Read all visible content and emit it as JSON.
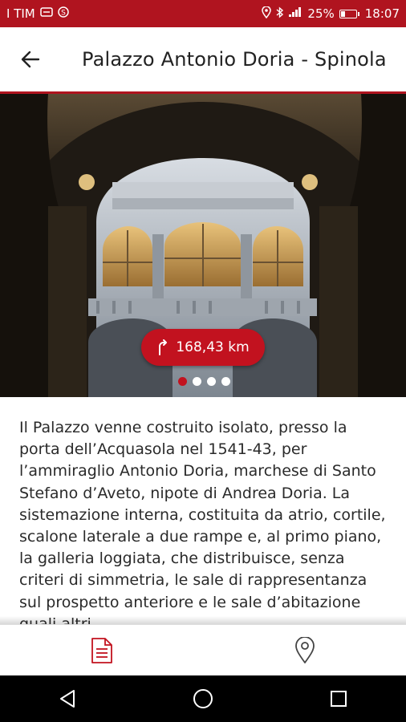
{
  "status_bar": {
    "carrier": "I TIM",
    "battery": "25%",
    "time": "18:07",
    "icons": [
      "message-icon",
      "skype-icon",
      "location-icon",
      "bluetooth-icon",
      "signal-icon",
      "battery-icon"
    ]
  },
  "header": {
    "title": "Palazzo Antonio Doria - Spinola",
    "back_icon": "arrow-back-icon",
    "accent_color": "#b0141f"
  },
  "gallery": {
    "distance": "168,43 km",
    "distance_icon": "walk-direction-icon",
    "image_count": 4,
    "active_index": 0
  },
  "description": {
    "text": "Il Palazzo venne costruito isolato, presso la porta dell’Acquasola nel 1541-43, per l’ammiraglio Antonio Doria, marchese di Santo Stefano d’Aveto, nipote di Andrea Doria. La sistemazione interna, costituita da atrio, cortile, scalone laterale a due rampe e, al primo piano, la galleria loggiata, che distribuisce, senza criteri di simmetria, le sale di rappresentanza sul prospetto anteriore e le sale d’abitazione quali altri"
  },
  "bottom_nav": {
    "items": [
      {
        "icon": "document-icon",
        "active": true
      },
      {
        "icon": "map-pin-icon",
        "active": false
      }
    ]
  },
  "system_nav": {
    "buttons": [
      "back-triangle-icon",
      "home-circle-icon",
      "recents-square-icon"
    ]
  }
}
